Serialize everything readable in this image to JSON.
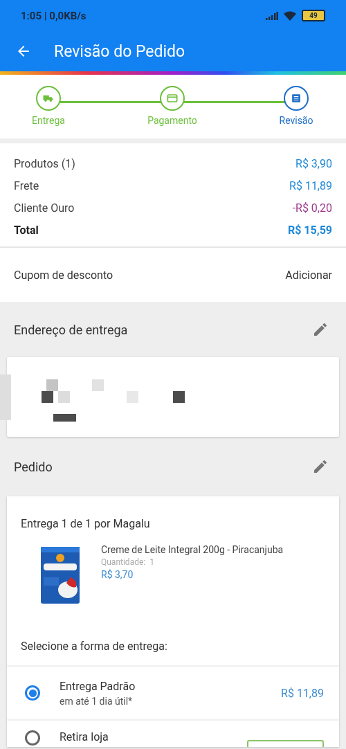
{
  "status_bar": {
    "time": "1:05 | 0,0KB/s",
    "battery": "49"
  },
  "header": {
    "title": "Revisão do Pedido"
  },
  "steps": [
    {
      "label": "Entrega",
      "kind": "truck",
      "selected": false
    },
    {
      "label": "Pagamento",
      "kind": "card",
      "selected": false
    },
    {
      "label": "Revisão",
      "kind": "list",
      "selected": true
    }
  ],
  "summary": [
    {
      "label": "Produtos (1)",
      "value": "R$ 3,90",
      "kind": "normal"
    },
    {
      "label": "Frete",
      "value": "R$ 11,89",
      "kind": "normal"
    },
    {
      "label": "Cliente Ouro",
      "value": "-R$ 0,20",
      "kind": "discount"
    },
    {
      "label": "Total",
      "value": "R$ 15,59",
      "kind": "total"
    }
  ],
  "coupon": {
    "label": "Cupom de desconto",
    "action": "Adicionar"
  },
  "address": {
    "title": "Endereço de entrega"
  },
  "order": {
    "title": "Pedido",
    "shipment": "Entrega 1 de 1 por Magalu",
    "product": {
      "name": "Creme de Leite Integral 200g - Piracanjuba",
      "quantity": "Quantidade:  1",
      "price": "R$ 3,70"
    },
    "delivery_prompt": "Selecione a forma de entrega:",
    "options": [
      {
        "name": "Entrega Padrão",
        "detail": "em até 1 dia útil*",
        "price": "R$ 11,89",
        "selected": true
      },
      {
        "name": "Retira loja",
        "selected": false
      }
    ]
  }
}
